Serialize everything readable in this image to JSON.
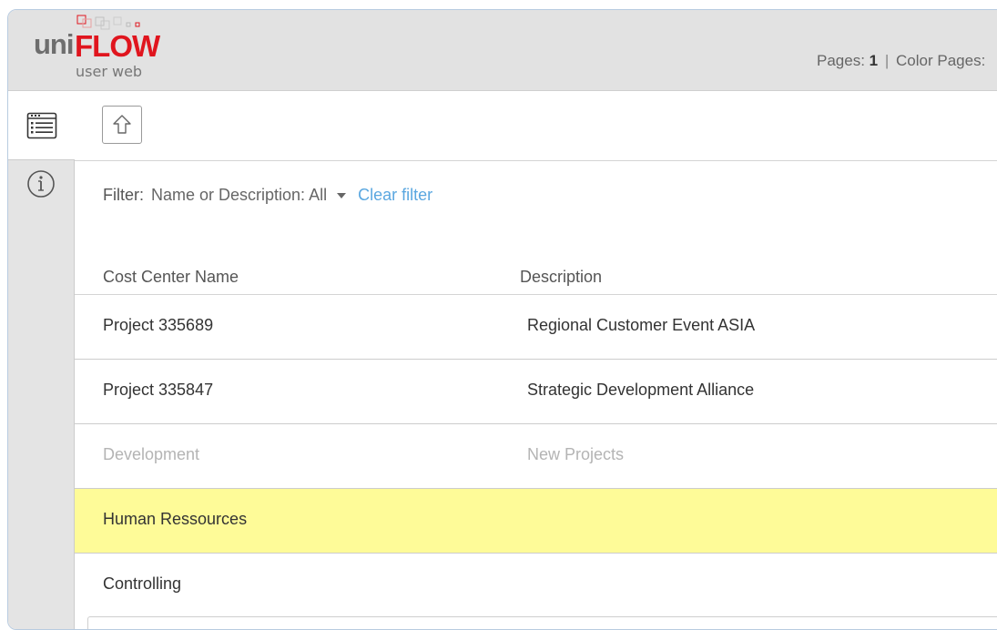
{
  "header": {
    "logo_uni": "uni",
    "logo_flow": "FLOW",
    "logo_sub": "user web",
    "pages_label": "Pages:",
    "pages_value": "1",
    "color_pages_label": "Color Pages:"
  },
  "sidebar": {
    "items": [
      {
        "icon": "list-icon"
      },
      {
        "icon": "info-icon"
      }
    ]
  },
  "toolbar": {
    "up_icon": "up-arrow-icon"
  },
  "filter": {
    "label": "Filter:",
    "value": "Name or Description: All",
    "clear_label": "Clear filter"
  },
  "table": {
    "columns": [
      "Cost Center Name",
      "Description"
    ],
    "rows": [
      {
        "name": "Project 335689",
        "description": "Regional Customer Event ASIA",
        "state": "normal"
      },
      {
        "name": "Project 335847",
        "description": "Strategic Development Alliance",
        "state": "normal"
      },
      {
        "name": "Development",
        "description": "New Projects",
        "state": "disabled"
      },
      {
        "name": "Human Ressources",
        "description": "",
        "state": "selected"
      },
      {
        "name": "Controlling",
        "description": "",
        "state": "normal"
      }
    ]
  },
  "colors": {
    "brand_red": "#e0151e",
    "link_blue": "#5aa7e0",
    "selected_row": "#fefb98",
    "header_bg": "#e2e2e2"
  }
}
